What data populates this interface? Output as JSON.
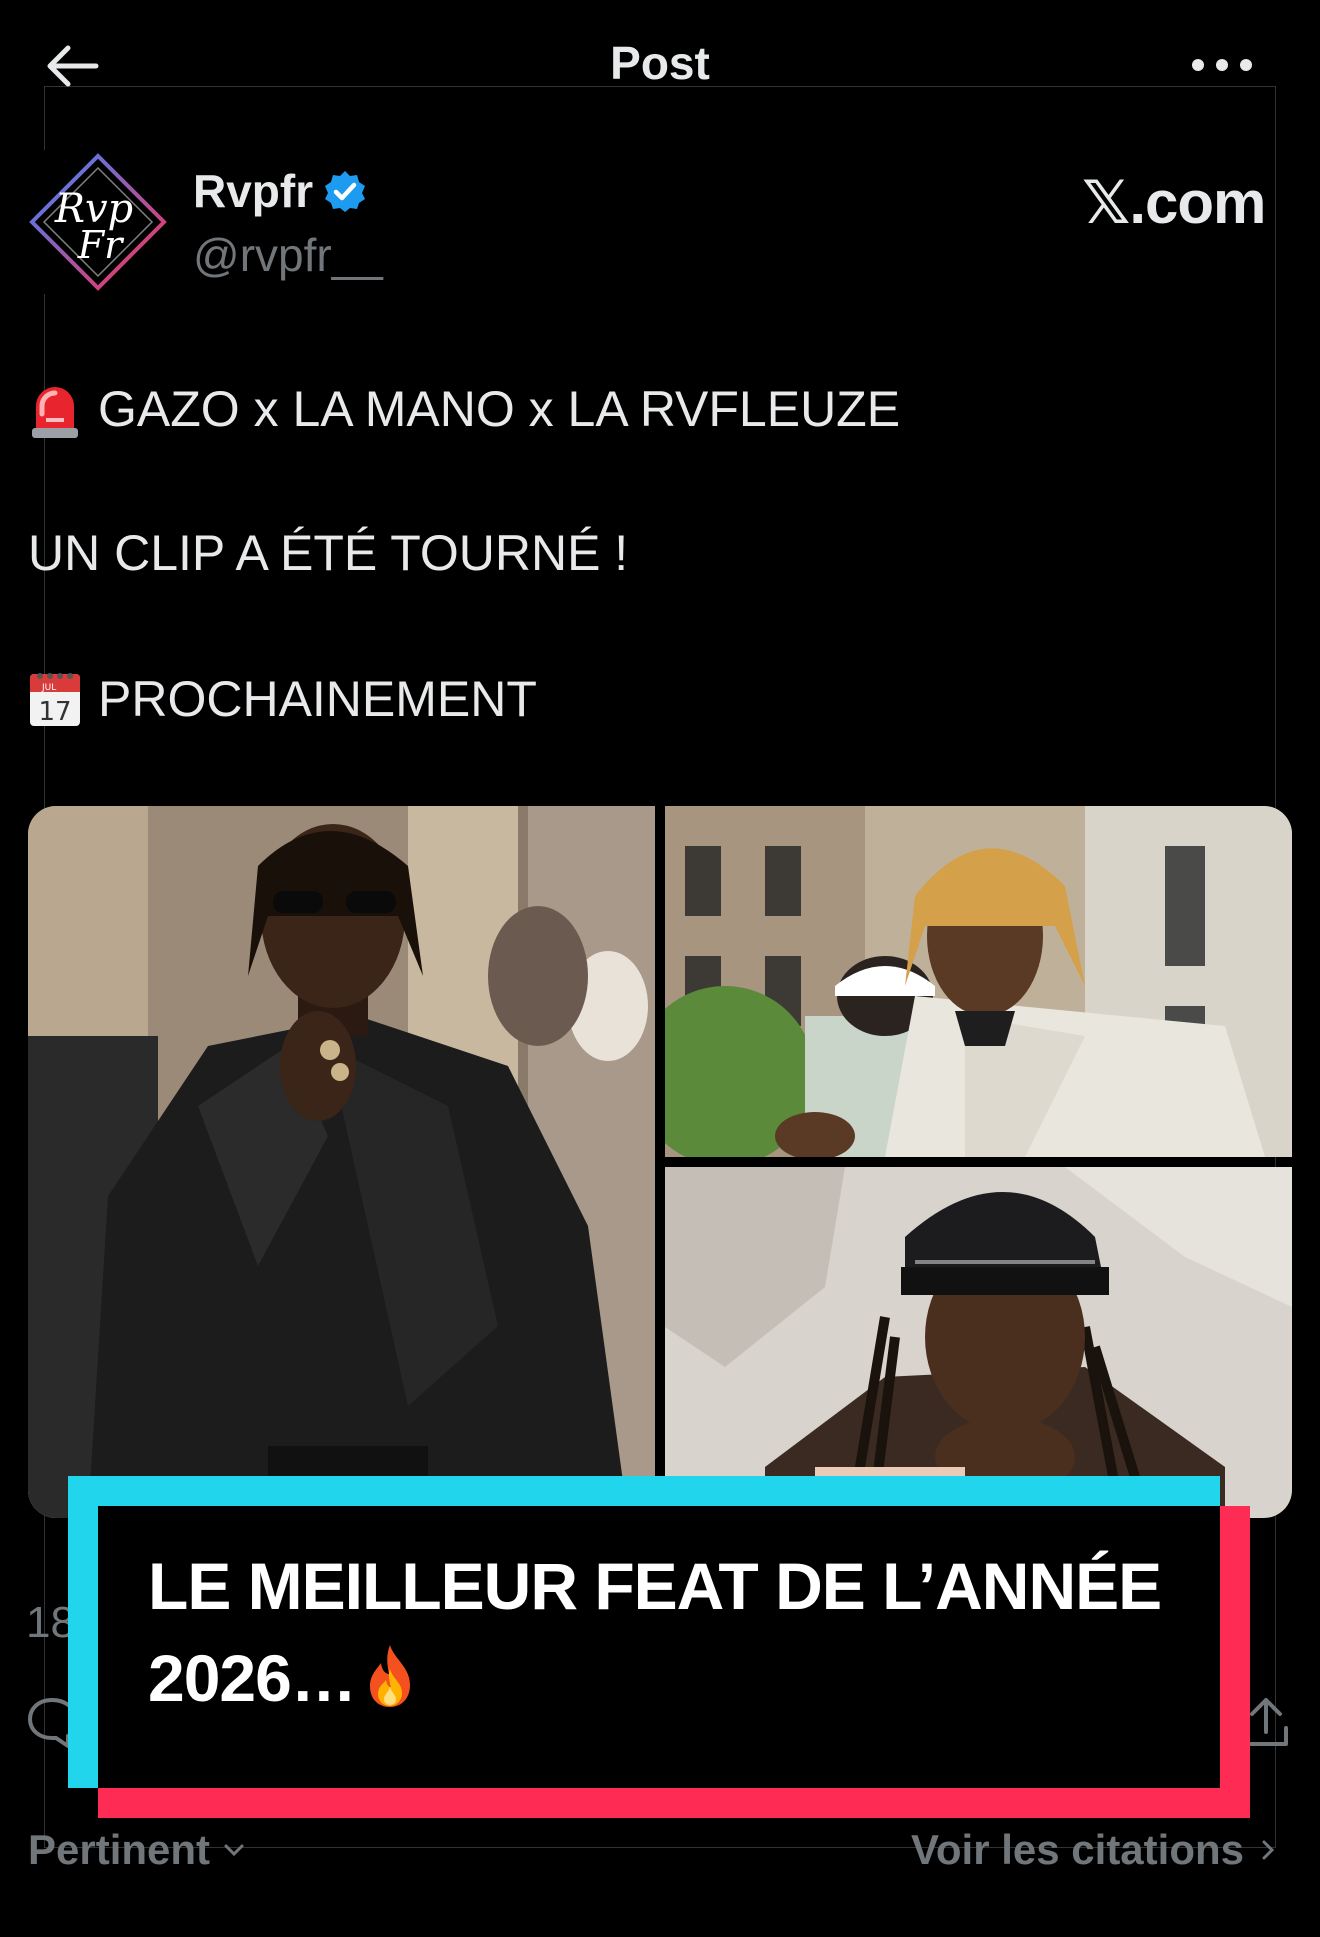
{
  "header": {
    "title": "Post"
  },
  "author": {
    "name": "Rvpfr",
    "handle": "@rvpfr__",
    "verified": true
  },
  "site_label": {
    "x": "𝕏",
    "rest": ".com"
  },
  "tweet": {
    "line1": "GAZO x LA MANO x LA RVFLEUZE",
    "line2": "UN CLIP A ÉTÉ TOURNÉ !",
    "line3": "PROCHAINEMENT",
    "emoji1": "rotating-light",
    "emoji2": "calendar",
    "calendar_month": "JUL",
    "calendar_day": "17"
  },
  "overlay": {
    "line1": "LE MEILLEUR FEAT DE L’ANNÉE",
    "line2": "2026…",
    "emoji": "fire"
  },
  "footer": {
    "count_partial": "18",
    "sort_label": "Pertinent",
    "quotes_label": "Voir les citations"
  },
  "colors": {
    "accent": "#1d9bf0",
    "cyan": "#20d5ec",
    "red": "#fe2c55",
    "muted": "#71767b"
  }
}
